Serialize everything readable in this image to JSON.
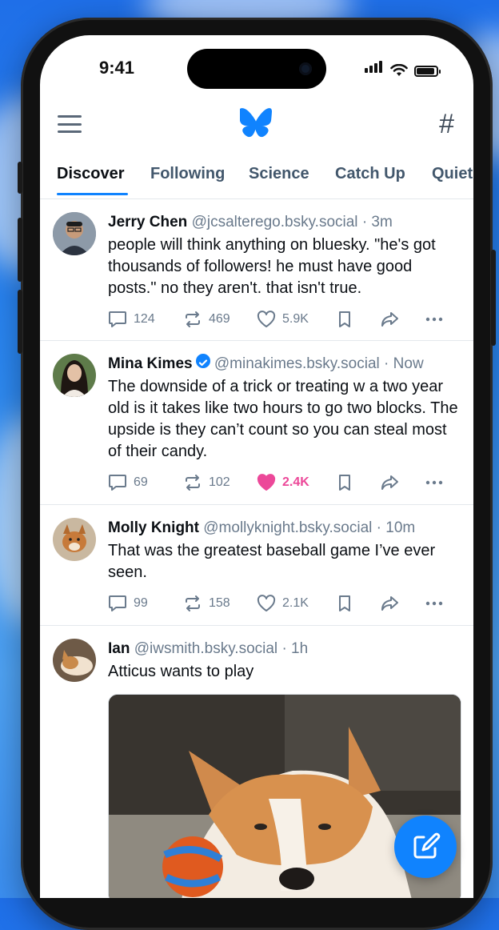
{
  "status_bar": {
    "time": "9:41"
  },
  "header": {
    "logo_icon": "butterfly-icon",
    "menu_icon": "hamburger-icon",
    "feeds_icon": "hash-icon",
    "feeds_glyph": "#"
  },
  "tabs": [
    {
      "label": "Discover",
      "active": true
    },
    {
      "label": "Following"
    },
    {
      "label": "Science"
    },
    {
      "label": "Catch Up"
    },
    {
      "label": "Quiet"
    }
  ],
  "posts": [
    {
      "name": "Jerry Chen",
      "handle": "@jcsalterego.bsky.social",
      "time": "· 3m",
      "text": "people will think anything on bluesky. \"he's got thousands of followers! he must have good posts.\" no they aren't. that isn't true.",
      "replies": "124",
      "reposts": "469",
      "likes": "5.9K",
      "liked": false
    },
    {
      "name": "Mina Kimes",
      "verified": true,
      "handle": "@minakimes.bsky.social",
      "time": "· Now",
      "text": "The downside of a trick or treating w a two year old is it takes like two hours to go two blocks. The upside is they can’t count so you can steal most of their candy.",
      "replies": "69",
      "reposts": "102",
      "likes": "2.4K",
      "liked": true
    },
    {
      "name": "Molly Knight",
      "handle": "@mollyknight.bsky.social",
      "time": "· 10m",
      "text": "That was the greatest baseball game I’ve ever seen.",
      "replies": "99",
      "reposts": "158",
      "likes": "2.1K",
      "liked": false
    },
    {
      "name": "Ian",
      "handle": "@iwsmith.bsky.social",
      "time": "· 1h",
      "text": "Atticus wants to play"
    }
  ],
  "colors": {
    "accent": "#1083fe",
    "like": "#ec4899",
    "muted": "#6a7a8c"
  },
  "fab": {
    "icon": "compose-icon"
  }
}
